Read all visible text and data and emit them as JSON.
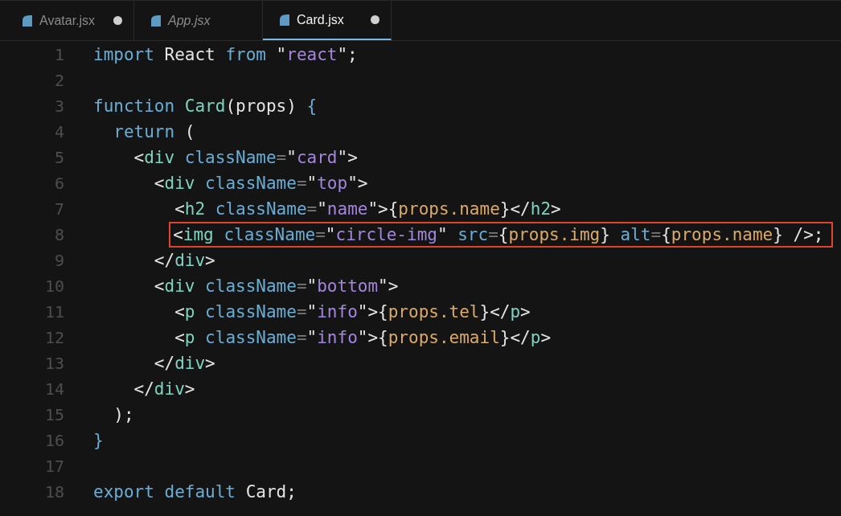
{
  "tabs": [
    {
      "label": "Avatar.jsx",
      "selected": false,
      "modified": true,
      "preview": false
    },
    {
      "label": "App.jsx",
      "selected": false,
      "modified": false,
      "preview": true
    },
    {
      "label": "Card.jsx",
      "selected": true,
      "modified": true,
      "preview": false
    }
  ],
  "editor": {
    "lines": [
      {
        "number": "1",
        "highlighted": false,
        "tokens": [
          {
            "keyword": "import"
          },
          {
            "plain": " React "
          },
          {
            "keyword": "from"
          },
          {
            "plain": " \""
          },
          {
            "string": "react"
          },
          {
            "plain": "\";"
          }
        ]
      },
      {
        "number": "2",
        "highlighted": false
      },
      {
        "number": "3",
        "highlighted": false,
        "tokens": [
          {
            "keyword": "function "
          },
          {
            "tag": "Card"
          },
          {
            "plain": "(props) "
          },
          {
            "keyword": "{"
          }
        ]
      },
      {
        "number": "4",
        "highlighted": false,
        "tokens": [
          {
            "keyword": "  return"
          },
          {
            "plain": " ("
          }
        ]
      },
      {
        "number": "5",
        "highlighted": false,
        "tokens": [
          {
            "plain": "    <"
          },
          {
            "tag": "div"
          },
          {
            "attr": " className"
          },
          {
            "op": "="
          },
          {
            "plain": "\""
          },
          {
            "string": "card"
          },
          {
            "plain": "\">"
          }
        ]
      },
      {
        "number": "6",
        "highlighted": false,
        "tokens": [
          {
            "plain": "      <"
          },
          {
            "tag": "div"
          },
          {
            "attr": " className"
          },
          {
            "op": "="
          },
          {
            "plain": "\""
          },
          {
            "string": "top"
          },
          {
            "plain": "\">"
          }
        ]
      },
      {
        "number": "7",
        "highlighted": false,
        "tokens": [
          {
            "plain": "        <"
          },
          {
            "tag": "h2"
          },
          {
            "attr": " className"
          },
          {
            "op": "="
          },
          {
            "plain": "\""
          },
          {
            "string": "name"
          },
          {
            "plain": "\">{"
          },
          {
            "expr": "props.name"
          },
          {
            "plain": "}</"
          },
          {
            "tag": "h2"
          },
          {
            "plain": ">"
          }
        ]
      },
      {
        "number": "8",
        "highlighted": true,
        "tokens": [
          {
            "plain": "<"
          },
          {
            "tag": "img"
          },
          {
            "attr": " className"
          },
          {
            "op": "="
          },
          {
            "plain": "\""
          },
          {
            "string": "circle-img"
          },
          {
            "plain": "\""
          },
          {
            "attr": " src"
          },
          {
            "op": "="
          },
          {
            "plain": "{"
          },
          {
            "expr": "props.img"
          },
          {
            "plain": "}"
          },
          {
            "attr": " alt"
          },
          {
            "op": "="
          },
          {
            "plain": "{"
          },
          {
            "expr": "props.name"
          },
          {
            "plain": "} />;"
          }
        ]
      },
      {
        "number": "9",
        "highlighted": false,
        "tokens": [
          {
            "plain": "      </"
          },
          {
            "tag": "div"
          },
          {
            "plain": ">"
          }
        ]
      },
      {
        "number": "10",
        "highlighted": false,
        "tokens": [
          {
            "plain": "      <"
          },
          {
            "tag": "div"
          },
          {
            "attr": " className"
          },
          {
            "op": "="
          },
          {
            "plain": "\""
          },
          {
            "string": "bottom"
          },
          {
            "plain": "\">"
          }
        ]
      },
      {
        "number": "11",
        "highlighted": false,
        "tokens": [
          {
            "plain": "        <"
          },
          {
            "tag": "p"
          },
          {
            "attr": " className"
          },
          {
            "op": "="
          },
          {
            "plain": "\""
          },
          {
            "string": "info"
          },
          {
            "plain": "\">{"
          },
          {
            "expr": "props.tel"
          },
          {
            "plain": "}</"
          },
          {
            "tag": "p"
          },
          {
            "plain": ">"
          }
        ]
      },
      {
        "number": "12",
        "highlighted": false,
        "tokens": [
          {
            "plain": "        <"
          },
          {
            "tag": "p"
          },
          {
            "attr": " className"
          },
          {
            "op": "="
          },
          {
            "plain": "\""
          },
          {
            "string": "info"
          },
          {
            "plain": "\">{"
          },
          {
            "expr": "props.email"
          },
          {
            "plain": "}</"
          },
          {
            "tag": "p"
          },
          {
            "plain": ">"
          }
        ]
      },
      {
        "number": "13",
        "highlighted": false,
        "tokens": [
          {
            "plain": "      </"
          },
          {
            "tag": "div"
          },
          {
            "plain": ">"
          }
        ]
      },
      {
        "number": "14",
        "highlighted": false,
        "tokens": [
          {
            "plain": "    </"
          },
          {
            "tag": "div"
          },
          {
            "plain": ">"
          }
        ]
      },
      {
        "number": "15",
        "highlighted": false,
        "tokens": [
          {
            "plain": "  );"
          }
        ]
      },
      {
        "number": "16",
        "highlighted": false,
        "tokens": [
          {
            "keyword": "}"
          }
        ]
      },
      {
        "number": "17",
        "highlighted": false
      },
      {
        "number": "18",
        "highlighted": false,
        "tokens": [
          {
            "keyword": "export default"
          },
          {
            "plain": " Card;"
          }
        ]
      }
    ]
  }
}
